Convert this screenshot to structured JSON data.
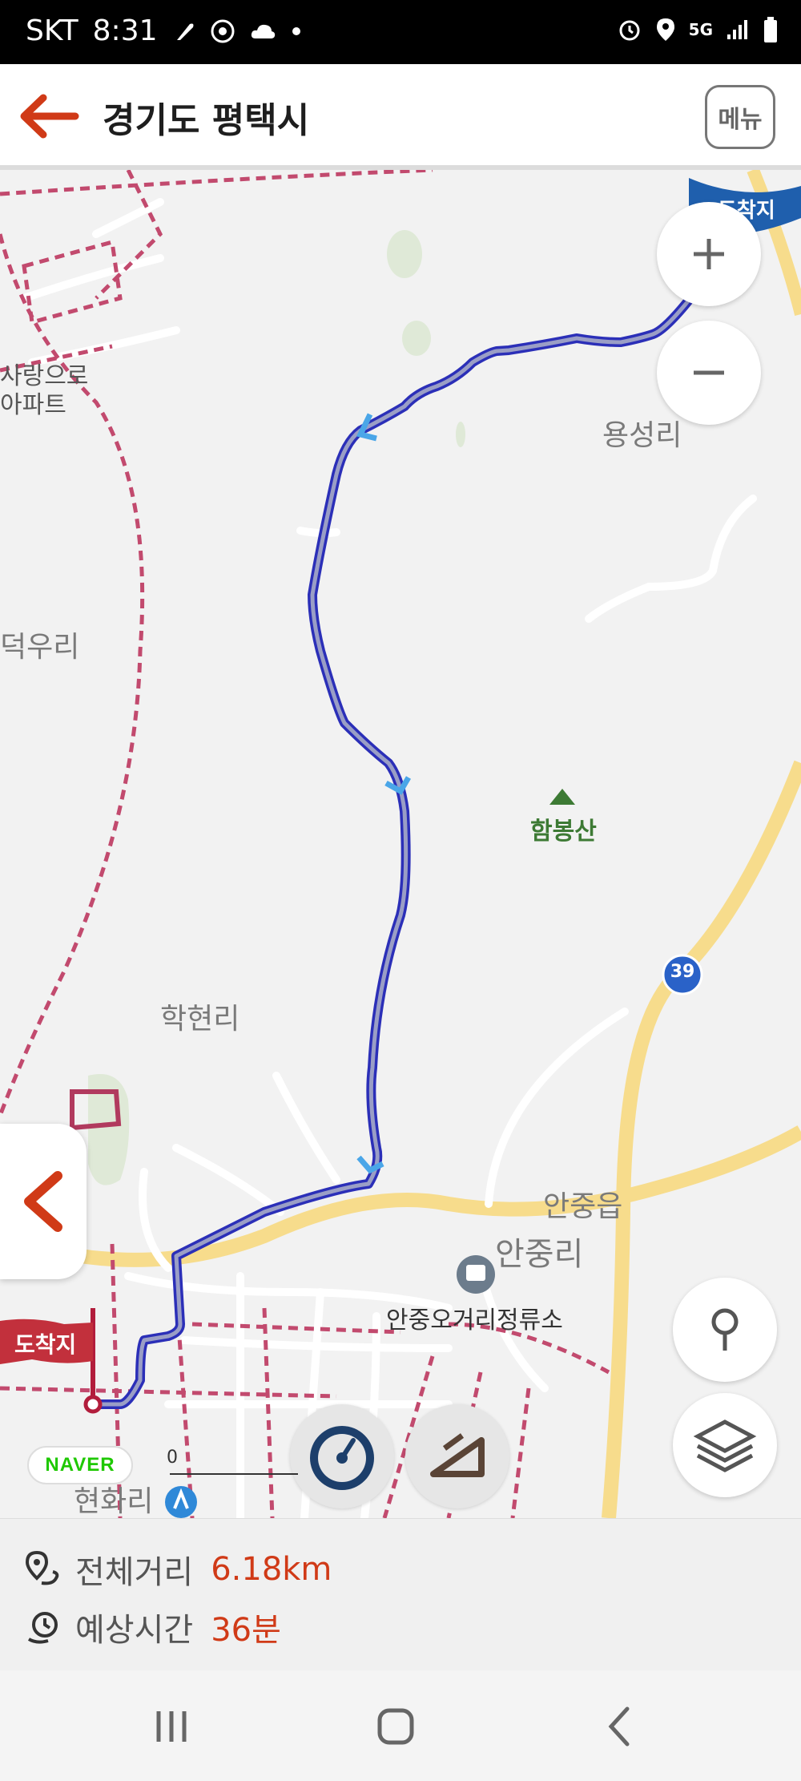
{
  "status_bar": {
    "carrier": "SKT",
    "time": "8:31",
    "network": "5G"
  },
  "header": {
    "title": "경기도 평택시",
    "menu_label": "메뉴"
  },
  "map": {
    "places": {
      "yongseong": "용성리",
      "hambongsan": "함봉산",
      "hakhyeon": "학현리",
      "deogu": "덕우리",
      "apartment_line1": "사랑으로",
      "apartment_line2": "아파트",
      "anjung_eup": "안중읍",
      "anjung_ri": "안중리",
      "bus_stop": "안중오거리정류소",
      "hyeonhwa": "현화리",
      "dest_top": "도착지"
    },
    "route_badge": "39",
    "destination_label": "도착지",
    "naver_logo": "NAVER",
    "scale_zero": "0"
  },
  "route_info": {
    "distance_label": "전체거리",
    "distance_value": "6.18km",
    "time_label": "예상시간",
    "time_value": "36분"
  },
  "colors": {
    "accent": "#d03a17",
    "route": "#2b2fb8",
    "road_yellow": "#f7dc8c"
  }
}
